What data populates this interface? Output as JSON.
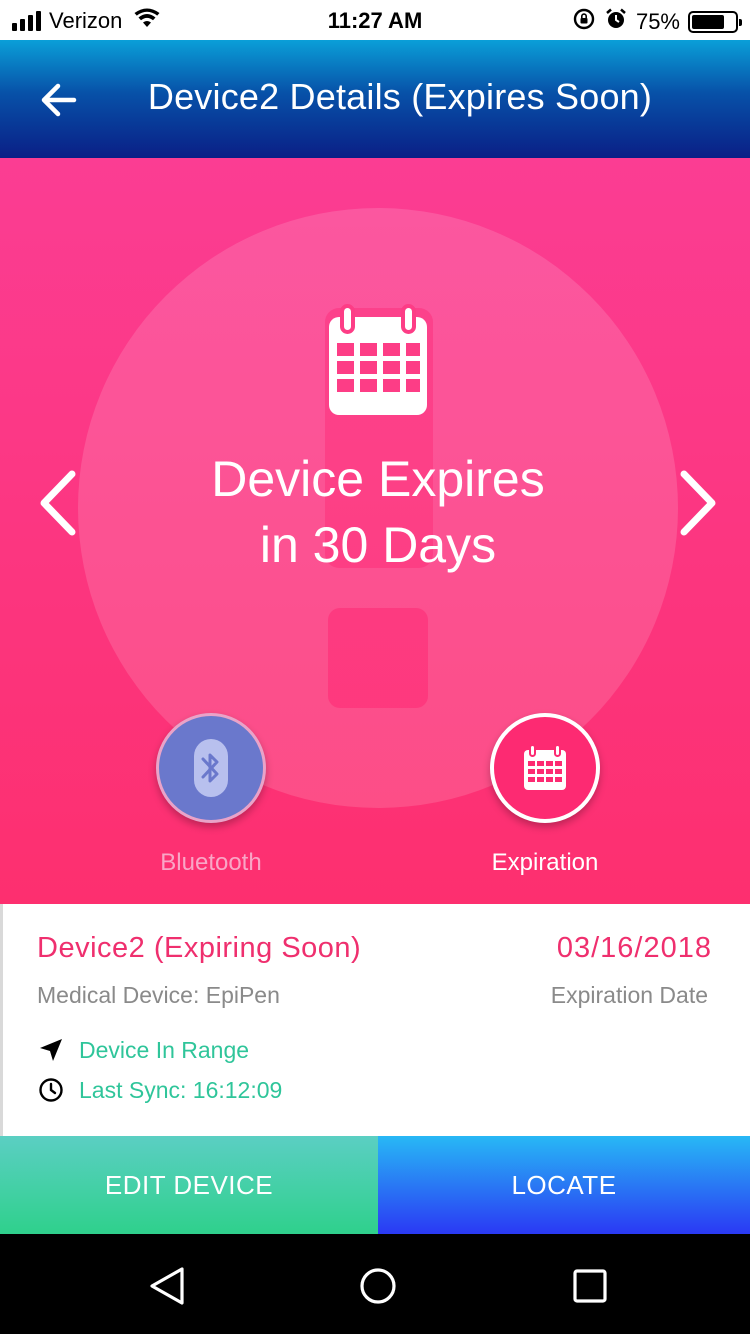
{
  "status_bar": {
    "carrier": "Verizon",
    "time": "11:27 AM",
    "battery_percent": "75%",
    "battery_level": 0.75
  },
  "header": {
    "title": "Device2 Details (Expires Soon)"
  },
  "hero": {
    "title_line1": "Device Expires",
    "title_line2": "in 30 Days",
    "features": {
      "bluetooth_label": "Bluetooth",
      "expiration_label": "Expiration"
    }
  },
  "device": {
    "name": "Device2 (Expiring Soon)",
    "type": "Medical Device: EpiPen",
    "expiration_date": "03/16/2018",
    "expiration_label": "Expiration Date",
    "range_status": "Device In Range",
    "last_sync": "Last Sync: 16:12:09"
  },
  "actions": {
    "edit_label": "EDIT DEVICE",
    "locate_label": "LOCATE"
  },
  "colors": {
    "accent_pink": "#ef2f6e",
    "status_green": "#2fc59a",
    "header_blue": "#0751a8"
  }
}
